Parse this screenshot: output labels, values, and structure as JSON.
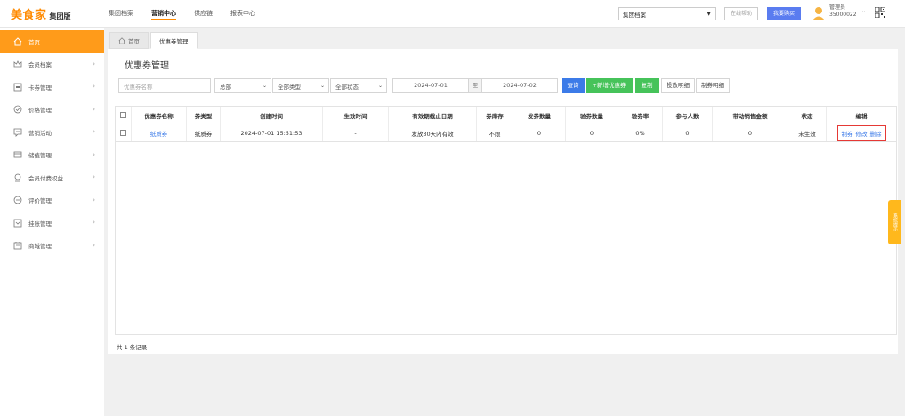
{
  "app": {
    "brand": "美食家",
    "edition": "集团版"
  },
  "topnav": [
    "集团档案",
    "营销中心",
    "供应链",
    "报表中心"
  ],
  "topnav_active": "营销中心",
  "header": {
    "org_select": "集团档案",
    "help": "在线帮助",
    "buy": "我要购买",
    "user_role": "管理员",
    "user_id": "35000022"
  },
  "sidebar": {
    "items": [
      {
        "label": "首页",
        "icon": "home-icon",
        "active": true
      },
      {
        "label": "会员档案",
        "icon": "crown-icon"
      },
      {
        "label": "卡券管理",
        "icon": "card-icon"
      },
      {
        "label": "价格管理",
        "icon": "price-icon"
      },
      {
        "label": "营销活动",
        "icon": "chat-icon"
      },
      {
        "label": "储值管理",
        "icon": "wallet-icon"
      },
      {
        "label": "会员付费权益",
        "icon": "vip-icon"
      },
      {
        "label": "评价管理",
        "icon": "comment-icon"
      },
      {
        "label": "挂账管理",
        "icon": "ledger-icon"
      },
      {
        "label": "商城管理",
        "icon": "shop-icon"
      }
    ]
  },
  "tabs": [
    {
      "label": "首页",
      "icon": "home-icon"
    },
    {
      "label": "优惠券管理"
    }
  ],
  "page_title": "优惠券管理",
  "filters": {
    "name_placeholder": "优惠券名称",
    "scope": "总部",
    "type": "全部类型",
    "status": "全部状态",
    "date_from": "2024-07-01",
    "date_sep": "至",
    "date_to": "2024-07-02",
    "btn_query": "查询",
    "btn_add": "+新增优惠券",
    "btn_copy": "复制",
    "btn_issue_detail": "投放明细",
    "btn_make_detail": "制券明细"
  },
  "table": {
    "headers": [
      "优惠券名称",
      "券类型",
      "创建时间",
      "生效时间",
      "有效期截止日期",
      "券库存",
      "发券数量",
      "验券数量",
      "验券率",
      "参与人数",
      "带动销售金额",
      "状态",
      "编辑"
    ],
    "rows": [
      {
        "name": "纸质券",
        "type": "纸质券",
        "created": "2024-07-01 15:51:53",
        "effective": "-",
        "expiry": "发放30天内有效",
        "stock": "不限",
        "issued": "0",
        "verified": "0",
        "rate": "0%",
        "participants": "0",
        "sales": "0",
        "status": "未生效",
        "actions": [
          "制券",
          "修改",
          "删除"
        ]
      }
    ]
  },
  "footer": {
    "count_text": "共 1 条记录"
  },
  "float_tab": "系统提示",
  "colors": {
    "brand": "#ff8a00",
    "sidebar_active": "#ff9b1a",
    "primary": "#3c7be8",
    "success": "#46c35a",
    "highlight": "#e53935"
  }
}
